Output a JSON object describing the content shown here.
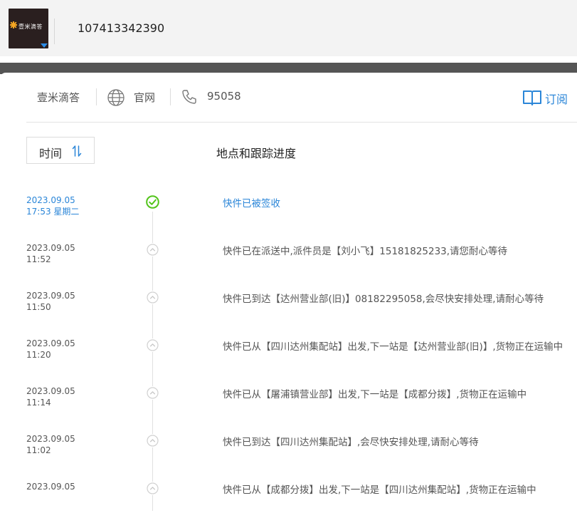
{
  "header": {
    "logo_text": "壹米滴答",
    "tracking_number": "107413342390"
  },
  "carrier": {
    "name": "壹米滴答",
    "website_label": "官网",
    "phone": "95058",
    "subscribe_label": "订阅"
  },
  "table": {
    "sort_label": "时间",
    "progress_header": "地点和跟踪进度"
  },
  "colors": {
    "accent": "#2b86d8",
    "delivered": "#52c41a",
    "text": "#555555"
  },
  "events": [
    {
      "date": "2023.09.05",
      "time": "17:53 星期二",
      "desc": "快件已被签收",
      "status": "delivered"
    },
    {
      "date": "2023.09.05",
      "time": "11:52",
      "desc": "快件已在派送中,派件员是【刘小飞】15181825233,请您耐心等待",
      "status": "transit"
    },
    {
      "date": "2023.09.05",
      "time": "11:50",
      "desc": "快件已到达【达州营业部(旧)】08182295058,会尽快安排处理,请耐心等待",
      "status": "transit"
    },
    {
      "date": "2023.09.05",
      "time": "11:20",
      "desc": "快件已从【四川达州集配站】出发,下一站是【达州营业部(旧)】,货物正在运输中",
      "status": "transit"
    },
    {
      "date": "2023.09.05",
      "time": "11:14",
      "desc": "快件已从【屠浦镇营业部】出发,下一站是【成都分拨】,货物正在运输中",
      "status": "transit"
    },
    {
      "date": "2023.09.05",
      "time": "11:02",
      "desc": "快件已到达【四川达州集配站】,会尽快安排处理,请耐心等待",
      "status": "transit"
    },
    {
      "date": "2023.09.05",
      "time": "",
      "desc": "快件已从【成都分拨】出发,下一站是【四川达州集配站】,货物正在运输中",
      "status": "transit"
    }
  ]
}
